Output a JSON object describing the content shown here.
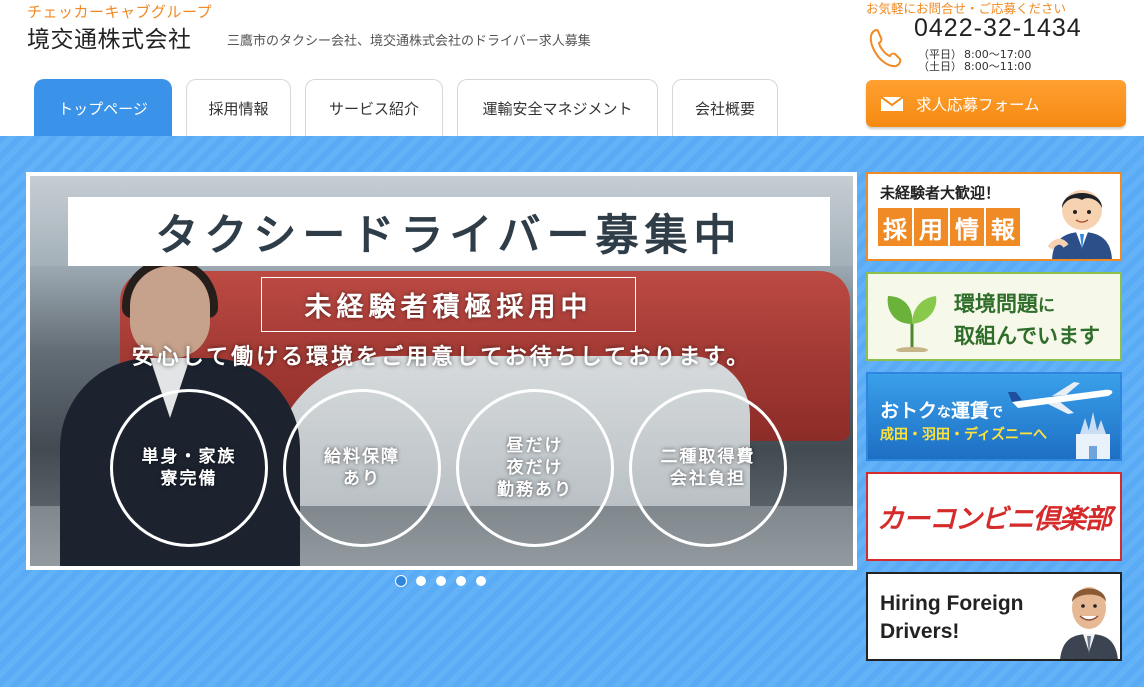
{
  "header": {
    "group_name": "チェッカーキャブグループ",
    "company_name": "境交通株式会社",
    "tagline": "三鷹市のタクシー会社、境交通株式会社のドライバー求人募集",
    "contact_note": "お気軽にお問合せ・ご応募ください",
    "phone": "0422-32-1434",
    "hours": [
      {
        "day": "（平日）",
        "time": "8:00～17:00"
      },
      {
        "day": "（土日）",
        "time": "8:00～11:00"
      }
    ],
    "apply_label": "求人応募フォーム"
  },
  "nav": {
    "tabs": [
      {
        "label": "トップページ",
        "active": true
      },
      {
        "label": "採用情報",
        "active": false
      },
      {
        "label": "サービス紹介",
        "active": false
      },
      {
        "label": "運輸安全マネジメント",
        "active": false
      },
      {
        "label": "会社概要",
        "active": false
      }
    ]
  },
  "slider": {
    "headline": "タクシードライバー募集中",
    "subheadline": "未経験者積極採用中",
    "tagline": "安心して働ける環境をご用意してお待ちしております。",
    "circles": [
      "単身・家族\n寮完備",
      "給料保障\nあり",
      "昼だけ\n夜だけ\n勤務あり",
      "二種取得費\n会社負担"
    ],
    "dot_count": 5,
    "active_dot": 0
  },
  "banners": {
    "recruit": {
      "line1": "未経験者大歓迎！",
      "line2": [
        "採",
        "用",
        "情",
        "報"
      ]
    },
    "environment": {
      "line1_main": "環境問題",
      "line1_suffix": "に",
      "line2": "取組んでいます"
    },
    "fare": {
      "line1_a": "おトク",
      "line1_b": "な",
      "line1_c": "運賃",
      "line1_d": "で",
      "line2": "成田・羽田・ディズニーへ"
    },
    "car_combini": {
      "text": "カーコンビニ倶楽部"
    },
    "foreign": {
      "text": "Hiring Foreign\nDrivers!"
    }
  },
  "colors": {
    "accent_orange": "#f08a24",
    "nav_active_blue": "#3a93e8",
    "main_bg_blue": "#5aabf5"
  }
}
